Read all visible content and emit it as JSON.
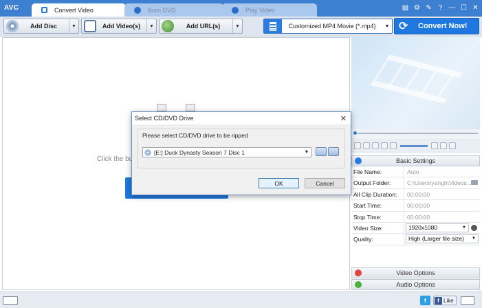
{
  "app": {
    "logo": "AVC"
  },
  "tabs": [
    {
      "label": "Convert Video",
      "active": true
    },
    {
      "label": "Burn DVD",
      "active": false
    },
    {
      "label": "Play Video",
      "active": false
    }
  ],
  "window_controls": {
    "feedback": "▤",
    "settings": "⚙",
    "tools": "✎",
    "help": "?",
    "minimize": "—",
    "maximize": "☐",
    "close": "✕"
  },
  "toolbar": {
    "add_disc": "Add Disc",
    "add_videos": "Add Video(s)",
    "add_urls": "Add URL(s)",
    "format": "Customized MP4 Movie (*.mp4)",
    "convert": "Convert Now!"
  },
  "main": {
    "hint": "Click the bu"
  },
  "basic_settings": {
    "title": "Basic Settings",
    "rows": [
      {
        "key": "File Name:",
        "value": "Auto"
      },
      {
        "key": "Output Folder:",
        "value": "C:\\Users\\yangh\\Videos..."
      },
      {
        "key": "All Clip Duration:",
        "value": "00:00:00"
      },
      {
        "key": "Start Time:",
        "value": "00:00:00"
      },
      {
        "key": "Stop Time:",
        "value": "00:00:00"
      },
      {
        "key": "Video Size:",
        "value": "1920x1080"
      },
      {
        "key": "Quality:",
        "value": "High (Larger file size)"
      }
    ]
  },
  "video_options": "Video Options",
  "audio_options": "Audio Options",
  "statusbar": {
    "like": "Like",
    "twitter": "t",
    "facebook": "f"
  },
  "dialog": {
    "title": "Select CD/DVD Drive",
    "close": "✕",
    "prompt": "Please select CD/DVD drive to be ripped",
    "drive": "[E:] Duck Dynasty Season 7 Disc 1",
    "ok": "OK",
    "cancel": "Cancel"
  },
  "colors": {
    "accent": "#1f78e0",
    "titlebar": "#3d7fd0"
  }
}
